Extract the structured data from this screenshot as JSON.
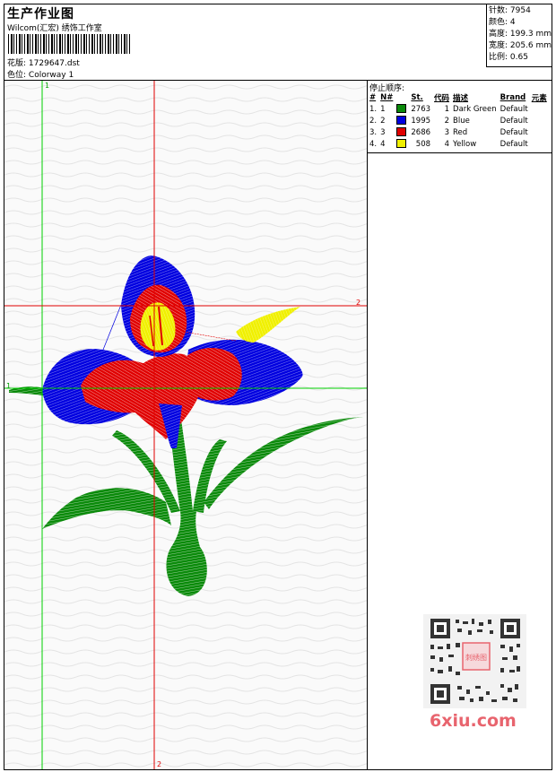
{
  "header": {
    "title": "生产作业图",
    "software": "Wilcom(汇宏) 绣饰工作室",
    "design_label": "花版:",
    "design_name": "1729647.dst",
    "colorway_label": "色位:",
    "colorway_name": "Colorway 1"
  },
  "stats": {
    "stitches": "针数: 7954",
    "colors": "颜色: 4",
    "height": "高度: 199.3 mm",
    "width": "宽度: 205.6 mm",
    "scale": "比例: 0.65"
  },
  "stop_sequence": {
    "label": "停止顺序:",
    "columns": [
      "#",
      "N#",
      "St.",
      "代码",
      "描述",
      "Brand",
      "元素"
    ],
    "rows": [
      {
        "idx": "1.",
        "n": "1",
        "color": "#0a8a0a",
        "stitches": "2763",
        "code": "1",
        "desc": "Dark Green",
        "brand": "Default"
      },
      {
        "idx": "2.",
        "n": "2",
        "color": "#0000e0",
        "stitches": "1995",
        "code": "2",
        "desc": "Blue",
        "brand": "Default"
      },
      {
        "idx": "3.",
        "n": "3",
        "color": "#e00000",
        "stitches": "2686",
        "code": "3",
        "desc": "Red",
        "brand": "Default"
      },
      {
        "idx": "4.",
        "n": "4",
        "color": "#f0f000",
        "stitches": "508",
        "code": "4",
        "desc": "Yellow",
        "brand": "Default"
      }
    ]
  },
  "guides": {
    "green_label_top": "1",
    "green_label_left": "1",
    "red_label_right": "2",
    "red_label_bottom": "2"
  },
  "watermark": {
    "text": "6xiu.com",
    "stamp_text": "刺绣图"
  },
  "colors": {
    "green": "#0a8a0a",
    "blue": "#0000e0",
    "red": "#e00000",
    "yellow": "#f0f000",
    "guide_green": "#00d000",
    "guide_red": "#e00000"
  }
}
